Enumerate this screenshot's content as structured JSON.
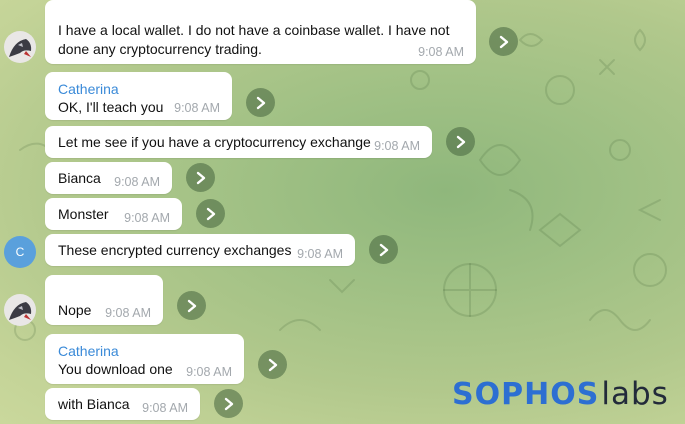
{
  "messages": [
    {
      "text": "I have a local wallet. I do not have a coinbase wallet. I have not\ndone any cryptocurrency trading.",
      "time": "9:08 AM"
    },
    {
      "sender": "Catherina",
      "text": "OK, I'll teach you",
      "time": "9:08 AM"
    },
    {
      "text": "Let me see if you have a cryptocurrency exchange",
      "time": "9:08 AM"
    },
    {
      "text": "Bianca",
      "time": "9:08 AM"
    },
    {
      "text": "Monster",
      "time": "9:08 AM"
    },
    {
      "text": "These encrypted currency exchanges",
      "time": "9:08 AM"
    },
    {
      "text": "Nope",
      "time": "9:08 AM"
    },
    {
      "sender": "Catherina",
      "text": "You download one",
      "time": "9:08 AM"
    },
    {
      "text": "with Bianca",
      "time": "9:08 AM"
    }
  ],
  "avatars": {
    "letter_avatar": "C"
  },
  "brand": {
    "part1": "SOPHOS",
    "part2": "labs"
  },
  "colors": {
    "sender_name": "#3a8ad8",
    "timestamp": "#a3a8ad",
    "letter_avatar_bg": "#5aa0dc",
    "brand_blue": "#2d6fd2"
  }
}
